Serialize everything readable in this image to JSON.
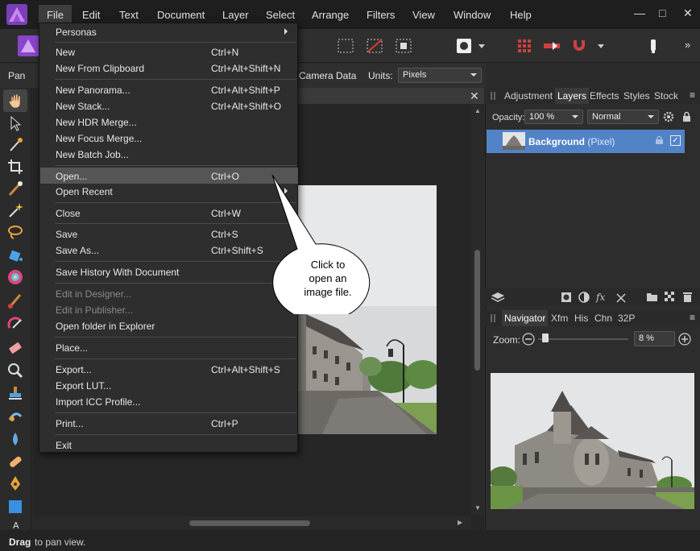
{
  "menubar": {
    "items": [
      "File",
      "Edit",
      "Text",
      "Document",
      "Layer",
      "Select",
      "Arrange",
      "Filters",
      "View",
      "Window",
      "Help"
    ],
    "window_buttons": [
      "—",
      "□",
      "✕"
    ]
  },
  "context": {
    "tool_label": "Pan",
    "camera_data": "Camera Data",
    "units_label": "Units:",
    "units_value": "Pixels"
  },
  "file_menu": {
    "items": [
      {
        "label": "Personas",
        "shortcut": "",
        "submenu": true
      },
      {
        "label": "New",
        "shortcut": "Ctrl+N"
      },
      {
        "label": "New From Clipboard",
        "shortcut": "Ctrl+Alt+Shift+N"
      },
      {
        "label": "New Panorama...",
        "shortcut": "Ctrl+Alt+Shift+P"
      },
      {
        "label": "New Stack...",
        "shortcut": "Ctrl+Alt+Shift+O"
      },
      {
        "label": "New HDR Merge...",
        "shortcut": ""
      },
      {
        "label": "New Focus Merge...",
        "shortcut": ""
      },
      {
        "label": "New Batch Job...",
        "shortcut": ""
      },
      {
        "label": "Open...",
        "shortcut": "Ctrl+O",
        "highlighted": true
      },
      {
        "label": "Open Recent",
        "shortcut": "",
        "submenu": true
      },
      {
        "label": "Close",
        "shortcut": "Ctrl+W"
      },
      {
        "label": "Save",
        "shortcut": "Ctrl+S"
      },
      {
        "label": "Save As...",
        "shortcut": "Ctrl+Shift+S"
      },
      {
        "label": "Save History With Document",
        "shortcut": ""
      },
      {
        "label": "Edit in Designer...",
        "shortcut": "",
        "disabled": true
      },
      {
        "label": "Edit in Publisher...",
        "shortcut": "",
        "disabled": true
      },
      {
        "label": "Open folder in Explorer",
        "shortcut": ""
      },
      {
        "label": "Place...",
        "shortcut": ""
      },
      {
        "label": "Export...",
        "shortcut": "Ctrl+Alt+Shift+S"
      },
      {
        "label": "Export LUT...",
        "shortcut": ""
      },
      {
        "label": "Import ICC Profile...",
        "shortcut": ""
      },
      {
        "label": "Print...",
        "shortcut": "Ctrl+P"
      },
      {
        "label": "Exit",
        "shortcut": ""
      }
    ]
  },
  "callout": {
    "line1": "Click to",
    "line2": "open an",
    "line3": "image file."
  },
  "layers_panel": {
    "tabs": [
      "Adjustment",
      "Layers",
      "Effects",
      "Styles",
      "Stock"
    ],
    "selected_tab": "Layers",
    "opacity_label": "Opacity:",
    "opacity_value": "100 %",
    "blend_mode": "Normal",
    "layer_name": "Background",
    "layer_type": "(Pixel)"
  },
  "navigator_panel": {
    "tabs": [
      "Navigator",
      "Xfm",
      "His",
      "Chn",
      "32P"
    ],
    "selected_tab": "Navigator",
    "zoom_label": "Zoom:",
    "zoom_value": "8 %",
    "zoom_level": 0.08
  },
  "status": {
    "bold": "Drag",
    "text": "to pan view."
  },
  "colors": {
    "accent": "#5283c7",
    "app_purple": "#9b4fd9",
    "menu_bg": "#2e2e2e",
    "highlight": "#555555"
  }
}
